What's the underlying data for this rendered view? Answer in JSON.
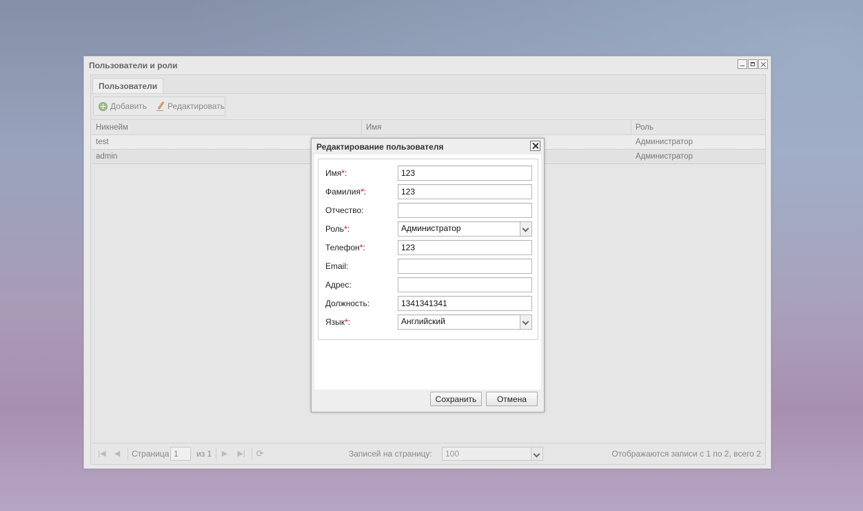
{
  "window": {
    "title": "Пользователи и роли"
  },
  "tabs": [
    {
      "label": "Пользователи"
    }
  ],
  "toolbar": {
    "add_label": "Добавить",
    "edit_label": "Редактировать"
  },
  "grid": {
    "columns": [
      "Никнейм",
      "Имя",
      "Роль"
    ],
    "rows": [
      {
        "nickname": "test",
        "name": "",
        "role": "Администратор"
      },
      {
        "nickname": "admin",
        "name": "",
        "role": "Администратор"
      }
    ]
  },
  "paging": {
    "page_label": "Страница",
    "page_value": "1",
    "of_label": "из 1",
    "per_page_label": "Записей на страницу:",
    "per_page_value": "100",
    "status": "Отображаются записи с 1 по 2, всего 2"
  },
  "dialog": {
    "title": "Редактирование пользователя",
    "fields": [
      {
        "label": "Имя",
        "required": "*",
        "suffix": ":",
        "value": "123",
        "type": "text"
      },
      {
        "label": "Фамилия",
        "required": "*",
        "suffix": ":",
        "value": "123",
        "type": "text"
      },
      {
        "label": "Отчество:",
        "required": "",
        "suffix": "",
        "value": "",
        "type": "text"
      },
      {
        "label": "Роль",
        "required": "*",
        "suffix": ":",
        "value": "Администратор",
        "type": "combo"
      },
      {
        "label": "Телефон",
        "required": "*",
        "suffix": ":",
        "value": "123",
        "type": "text"
      },
      {
        "label": "Email:",
        "required": "",
        "suffix": "",
        "value": "",
        "type": "text"
      },
      {
        "label": "Адрес:",
        "required": "",
        "suffix": "",
        "value": "",
        "type": "text"
      },
      {
        "label": "Должность:",
        "required": "",
        "suffix": "",
        "value": "1341341341",
        "type": "text"
      },
      {
        "label": "Язык",
        "required": "*",
        "suffix": ":",
        "value": "Английский",
        "type": "combo"
      }
    ],
    "save_label": "Сохранить",
    "cancel_label": "Отмена"
  }
}
